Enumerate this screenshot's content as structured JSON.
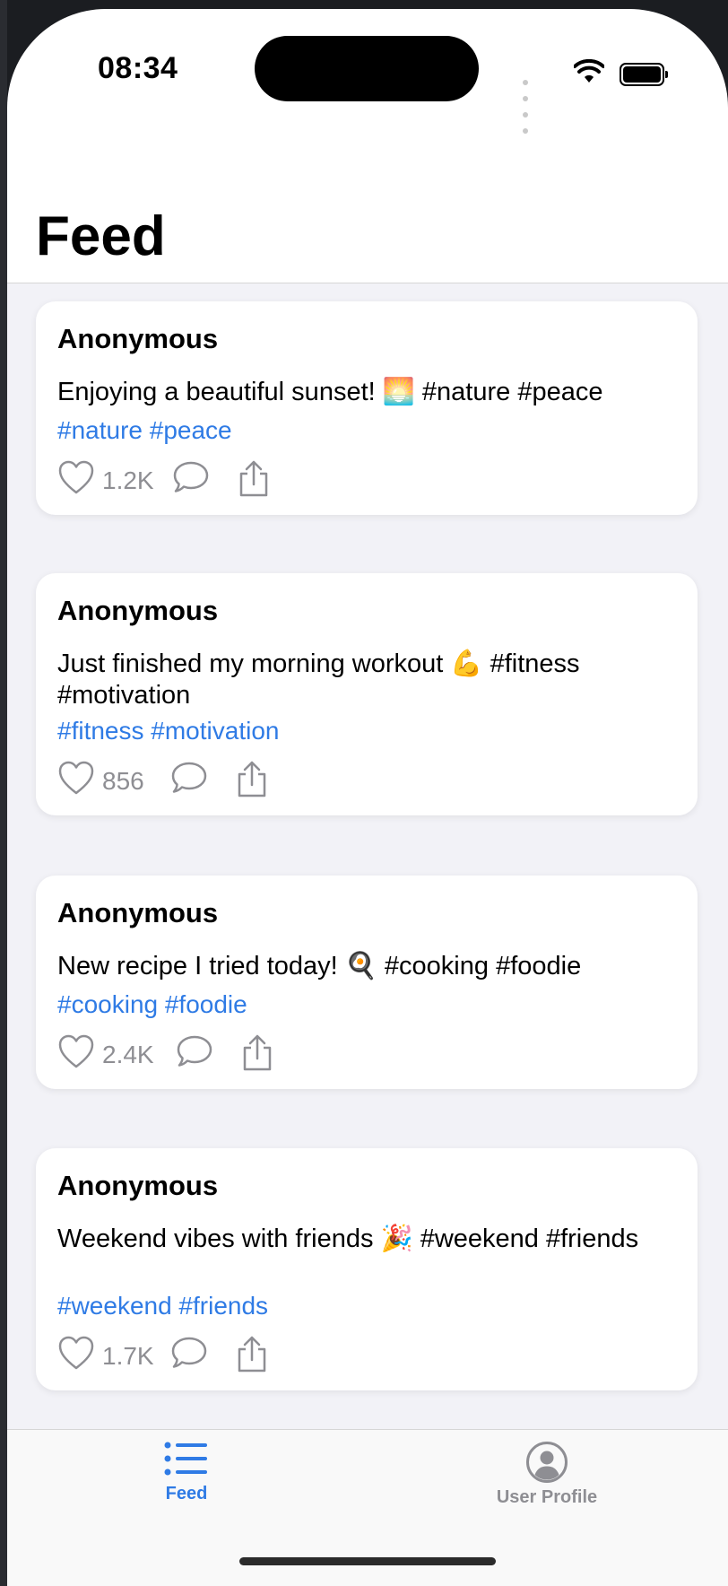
{
  "status_bar": {
    "time": "08:34"
  },
  "header": {
    "title": "Feed"
  },
  "posts": [
    {
      "author": "Anonymous",
      "text": "Enjoying a beautiful sunset! 🌅 #nature #peace",
      "tags": "#nature #peace",
      "likes": "1.2K"
    },
    {
      "author": "Anonymous",
      "text": "Just finished my morning workout 💪 #fitness #motivation",
      "tags": "#fitness #motivation",
      "likes": "856"
    },
    {
      "author": "Anonymous",
      "text": "New recipe I tried today! 🍳 #cooking #foodie",
      "tags": "#cooking #foodie",
      "likes": "2.4K"
    },
    {
      "author": "Anonymous",
      "text": "Weekend vibes with friends 🎉 #weekend #friends",
      "tags": "#weekend #friends",
      "likes": "1.7K"
    }
  ],
  "tabbar": {
    "tabs": [
      {
        "label": "Feed",
        "icon": "list-icon",
        "selected": true
      },
      {
        "label": "User Profile",
        "icon": "person-circle-icon",
        "selected": false
      }
    ]
  },
  "colors": {
    "accent": "#2f7be5",
    "inactive": "#8e8e93",
    "background": "#f2f2f7"
  }
}
